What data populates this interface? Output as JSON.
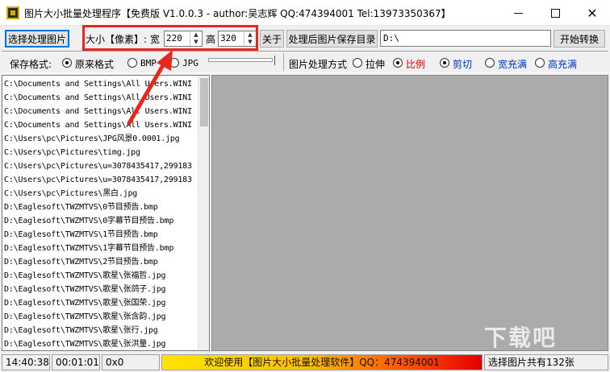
{
  "window": {
    "title": "图片大小批量处理程序【免费版 V1.0.0.3 - author:吴志辉  QQ:474394001 Tel:13973350367】",
    "min_glyph": "—",
    "close_glyph": "✕"
  },
  "toolbar": {
    "select_button": "选择处理图片",
    "size_label": "大小【像素】: 宽",
    "width_value": "220",
    "height_label": "高",
    "height_value": "320",
    "about_button": "关于",
    "save_dir_button": "处理后图片保存目录",
    "save_dir_value": "D:\\",
    "start_button": "开始转换"
  },
  "options": {
    "format_label": "保存格式:",
    "format_original": "原来格式",
    "format_bmp": "BMP",
    "format_jpg": "JPG",
    "process_label": "图片处理方式",
    "mode_stretch": "拉伸",
    "mode_ratio": "比例",
    "mode_crop": "剪切",
    "mode_fill_width": "宽充满",
    "mode_fill_height": "高充满"
  },
  "file_list": [
    "C:\\Documents and Settings\\All Users.WINI",
    "C:\\Documents and Settings\\All Users.WINI",
    "C:\\Documents and Settings\\All Users.WINI",
    "C:\\Documents and Settings\\All Users.WINI",
    "C:\\Users\\pc\\Pictures\\JPG风景0.0001.jpg",
    "C:\\Users\\pc\\Pictures\\timg.jpg",
    "C:\\Users\\pc\\Pictures\\u=3078435417,299183",
    "C:\\Users\\pc\\Pictures\\u=3078435417,299183",
    "C:\\Users\\pc\\Pictures\\黑白.jpg",
    "D:\\Eaglesoft\\TWZMTVS\\0节目预告.bmp",
    "D:\\Eaglesoft\\TWZMTVS\\0字幕节目预告.bmp",
    "D:\\Eaglesoft\\TWZMTVS\\1节目预告.bmp",
    "D:\\Eaglesoft\\TWZMTVS\\1字幕节目预告.bmp",
    "D:\\Eaglesoft\\TWZMTVS\\2节目预告.bmp",
    "D:\\Eaglesoft\\TWZMTVS\\歌星\\张福哲.jpg",
    "D:\\Eaglesoft\\TWZMTVS\\歌星\\张鸽子.jpg",
    "D:\\Eaglesoft\\TWZMTVS\\歌星\\张国荣.jpg",
    "D:\\Eaglesoft\\TWZMTVS\\歌星\\张含韵.jpg",
    "D:\\Eaglesoft\\TWZMTVS\\歌星\\张行.jpg",
    "D:\\Eaglesoft\\TWZMTVS\\歌星\\张洪量.jpg"
  ],
  "status": {
    "clock": "14:40:38",
    "elapsed": "00:01:01",
    "hex": "0x0",
    "banner": "欢迎使用【图片大小批量处理软件】QQ：474394001",
    "count": "选择图片共有132张"
  },
  "watermark": "下载吧",
  "colors": {
    "highlight": "#e8281e",
    "accent": "#0078d7",
    "banner_start": "#ffe400",
    "banner_end": "#e00000"
  }
}
